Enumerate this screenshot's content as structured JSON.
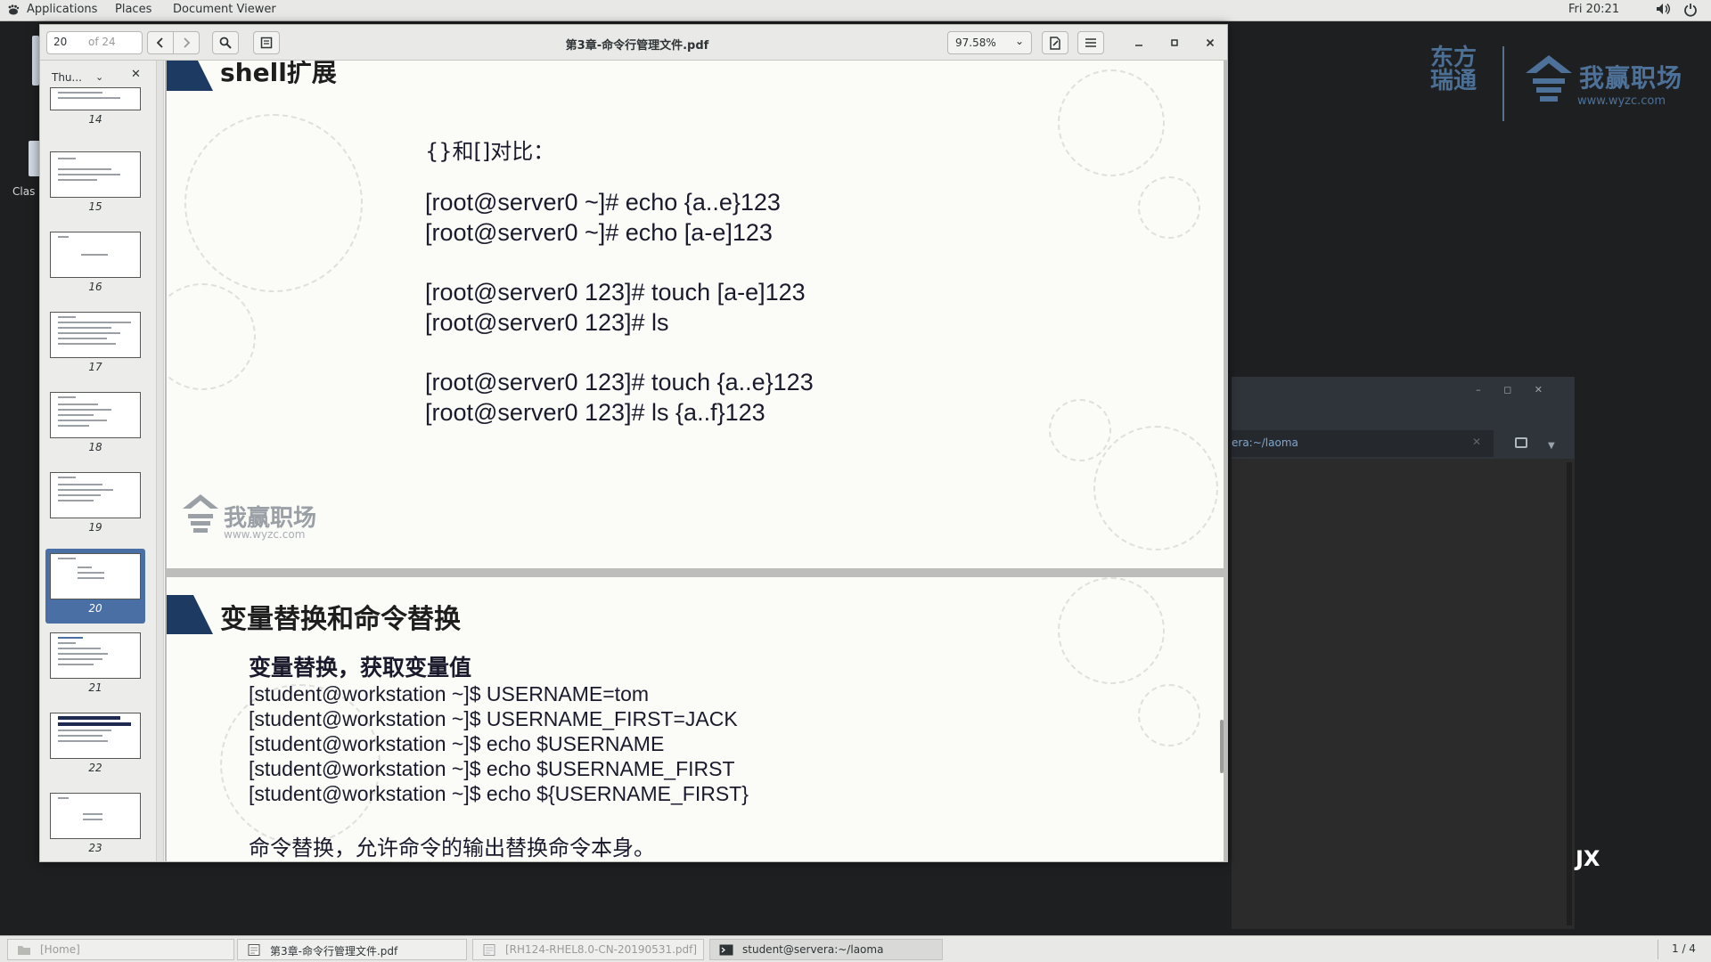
{
  "topbar": {
    "applications": "Applications",
    "places": "Places",
    "document_viewer": "Document Viewer",
    "clock": "Fri 20:21"
  },
  "desktop": {
    "cls_label": "Clas",
    "logo_dongfang": "东方瑞通",
    "logo_wyzc": "我赢职场",
    "logo_wyzc_url": "www.wyzc.com"
  },
  "viewer": {
    "page_number": "20",
    "page_total": "of 24",
    "title": "第3章-命令行管理文件.pdf",
    "zoom": "97.58%",
    "sidebar_mode": "Thu...",
    "thumbnails": [
      {
        "num": "14"
      },
      {
        "num": "15"
      },
      {
        "num": "16"
      },
      {
        "num": "17"
      },
      {
        "num": "18"
      },
      {
        "num": "19"
      },
      {
        "num": "20"
      },
      {
        "num": "21"
      },
      {
        "num": "22"
      },
      {
        "num": "23"
      }
    ]
  },
  "slide_top": {
    "heading": "shell扩展",
    "compare_title": "{}和[]对比：",
    "lines": [
      "[root@server0 ~]# echo {a..e}123",
      "[root@server0 ~]# echo [a-e]123",
      "[root@server0 123]# touch [a-e]123",
      "[root@server0 123]# ls",
      "[root@server0 123]# touch {a..e}123",
      "[root@server0 123]# ls {a..f}123"
    ],
    "logo_brand": "我赢职场",
    "logo_url": "www.wyzc.com"
  },
  "slide_bottom": {
    "heading": "变量替换和命令替换",
    "subheading": "变量替换，获取变量值",
    "lines": [
      "[student@workstation ~]$ USERNAME=tom",
      "[student@workstation ~]$ USERNAME_FIRST=JACK",
      "[student@workstation ~]$ echo $USERNAME",
      "[student@workstation ~]$ echo $USERNAME_FIRST",
      "[student@workstation ~]$ echo ${USERNAME_FIRST}"
    ],
    "footer_line": "命令替换，允许命令的输出替换命令本身。"
  },
  "terminal": {
    "tab_title": "era:~/laoma",
    "body_text": "JX"
  },
  "taskbar": {
    "home": "[Home]",
    "pdf1": "第3章-命令行管理文件.pdf",
    "pdf2": "[RH124-RHEL8.0-CN-20190531.pdf]",
    "terminal": "student@servera:~/laoma",
    "workspace": "1 / 4"
  }
}
